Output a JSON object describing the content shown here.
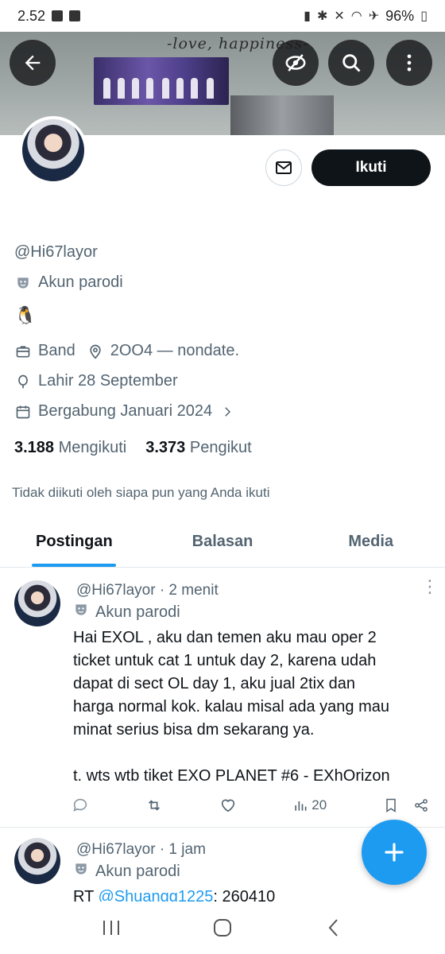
{
  "status_bar": {
    "time": "2.52",
    "battery": "96%"
  },
  "banner": {
    "text": "-love, happiness-"
  },
  "header_icons": {
    "back": "back-arrow-icon",
    "hide": "eye-slash-icon",
    "search": "search-icon",
    "more": "more-vertical-icon"
  },
  "profile": {
    "handle": "@Hi67layor",
    "account_type": "Akun parodi",
    "emoji": "🐧",
    "category": "Band",
    "location": "2OO4 — nondate.",
    "birthday": "Lahir 28 September",
    "joined": "Bergabung Januari 2024",
    "following_count": "3.188",
    "following_label": "Mengikuti",
    "followers_count": "3.373",
    "followers_label": "Pengikut",
    "not_followed_text": "Tidak diikuti oleh siapa pun yang Anda ikuti",
    "follow_button": "Ikuti"
  },
  "tabs": [
    {
      "label": "Postingan",
      "active": true
    },
    {
      "label": "Balasan",
      "active": false
    },
    {
      "label": "Media",
      "active": false
    }
  ],
  "posts": [
    {
      "header": "@Hi67layor · 2 menit",
      "badge": "Akun parodi",
      "lines": [
        "Hai EXOL , aku dan temen aku mau oper 2",
        "ticket untuk cat 1 untuk day 2, karena udah",
        "dapat di sect OL day 1, aku jual 2tix dan",
        "harga normal kok. kalau misal ada yang mau",
        "minat serius bisa dm sekarang ya.",
        "",
        "t. wts wtb tiket EXO PLANET #6 - EXhOrizon"
      ],
      "views": "20"
    },
    {
      "header": "@Hi67layor · 1 jam",
      "badge": "Akun parodi",
      "rt_prefix": "RT",
      "rt_mention": "@Shuangg1225",
      "rt_rest": ": 260410"
    }
  ],
  "colors": {
    "accent": "#1d9bf0",
    "text": "#0f1419",
    "muted": "#536471"
  }
}
